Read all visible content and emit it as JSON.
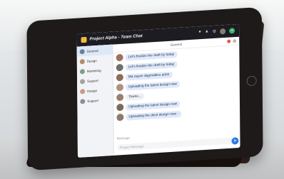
{
  "app": {
    "title": "Project Alpha - Team Chat"
  },
  "titlebar_icons": [
    "bell-icon",
    "lock-icon",
    "settings-icon",
    "avatar",
    "add-icon"
  ],
  "sidebar": {
    "items": [
      {
        "label": "General",
        "active": true,
        "avatar_color": "#6a7fa0"
      },
      {
        "label": "Design",
        "active": false,
        "avatar_color": "#b58b6b"
      },
      {
        "label": "Marketing",
        "active": false,
        "avatar_color": "#7ea08a"
      },
      {
        "label": "Support",
        "active": false,
        "avatar_color": "#a3a3a3"
      },
      {
        "label": "Design",
        "active": false,
        "avatar_color": "#c49a8a"
      },
      {
        "label": "Support",
        "active": false,
        "avatar_color": "#8a8f9a"
      }
    ]
  },
  "chat": {
    "channel": "General",
    "messages": [
      {
        "text": "Let's finalize the draft by today",
        "avatar_color": "#a07060",
        "style": "blue"
      },
      {
        "text": "Let's finalize the draft by today",
        "avatar_color": "#6f6f6f",
        "style": "blue"
      },
      {
        "text": "Ma nayve dagmables anhe",
        "avatar_color": "#8a6d5a",
        "style": "blue"
      },
      {
        "text": "Uploading the latest design now",
        "avatar_color": "#b09080",
        "style": "blue"
      },
      {
        "text": "Towne...",
        "avatar_color": "#9a7f70",
        "style": "white"
      },
      {
        "text": "Uploading the latest design now",
        "avatar_color": "#7a6a5a",
        "style": "blue"
      },
      {
        "text": "Uploading the diest design now -",
        "avatar_color": "#8d7b6c",
        "style": "blue"
      }
    ],
    "composer_placeholder": "Message",
    "reply_placeholder": "Project Message"
  },
  "colors": {
    "accent": "#2f7be8",
    "titlebar": "#1c1c22",
    "sidebar_active": "#dde8f7",
    "bubble": "#dfe9fb"
  }
}
